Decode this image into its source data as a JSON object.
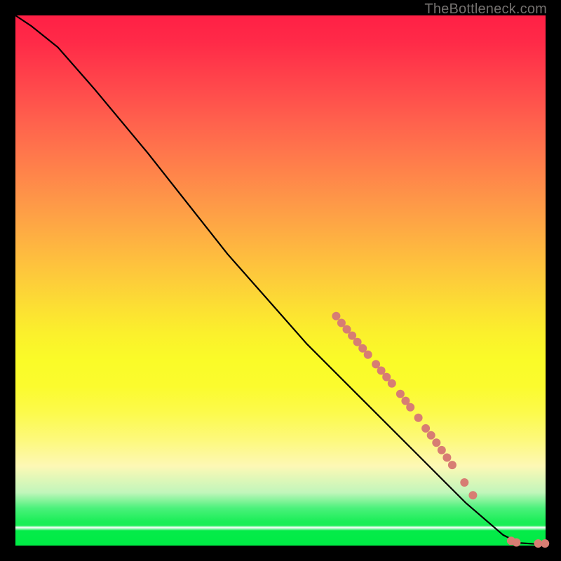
{
  "watermark": "TheBottleneck.com",
  "chart_data": {
    "type": "line",
    "title": "",
    "xlabel": "",
    "ylabel": "",
    "xlim": [
      0,
      100
    ],
    "ylim": [
      0,
      100
    ],
    "curve": [
      {
        "x": 0,
        "y": 100
      },
      {
        "x": 3,
        "y": 98
      },
      {
        "x": 8,
        "y": 94
      },
      {
        "x": 15,
        "y": 86
      },
      {
        "x": 25,
        "y": 74
      },
      {
        "x": 40,
        "y": 55
      },
      {
        "x": 55,
        "y": 38
      },
      {
        "x": 65,
        "y": 28
      },
      {
        "x": 75,
        "y": 18
      },
      {
        "x": 85,
        "y": 8
      },
      {
        "x": 92,
        "y": 2
      },
      {
        "x": 95,
        "y": 0.5
      },
      {
        "x": 98,
        "y": 0.3
      },
      {
        "x": 100,
        "y": 0.3
      }
    ],
    "markers": [
      {
        "x": 60.5,
        "y": 43.3,
        "r": 6
      },
      {
        "x": 61.5,
        "y": 42.0,
        "r": 6
      },
      {
        "x": 62.5,
        "y": 40.8,
        "r": 6
      },
      {
        "x": 63.5,
        "y": 39.6,
        "r": 6
      },
      {
        "x": 64.5,
        "y": 38.4,
        "r": 6
      },
      {
        "x": 65.5,
        "y": 37.2,
        "r": 6
      },
      {
        "x": 66.5,
        "y": 36.0,
        "r": 6
      },
      {
        "x": 68.0,
        "y": 34.2,
        "r": 6
      },
      {
        "x": 69.0,
        "y": 33.0,
        "r": 6
      },
      {
        "x": 70.0,
        "y": 31.8,
        "r": 6
      },
      {
        "x": 71.0,
        "y": 30.6,
        "r": 6
      },
      {
        "x": 72.6,
        "y": 28.6,
        "r": 6
      },
      {
        "x": 73.6,
        "y": 27.3,
        "r": 6
      },
      {
        "x": 74.5,
        "y": 26.1,
        "r": 6
      },
      {
        "x": 76.0,
        "y": 24.1,
        "r": 6
      },
      {
        "x": 77.4,
        "y": 22.1,
        "r": 6
      },
      {
        "x": 78.4,
        "y": 20.8,
        "r": 6
      },
      {
        "x": 79.4,
        "y": 19.4,
        "r": 6
      },
      {
        "x": 80.4,
        "y": 18.0,
        "r": 6
      },
      {
        "x": 81.4,
        "y": 16.6,
        "r": 6
      },
      {
        "x": 82.4,
        "y": 15.2,
        "r": 6
      },
      {
        "x": 84.7,
        "y": 11.9,
        "r": 6
      },
      {
        "x": 86.3,
        "y": 9.5,
        "r": 6
      },
      {
        "x": 93.5,
        "y": 0.9,
        "r": 6
      },
      {
        "x": 94.5,
        "y": 0.6,
        "r": 6
      },
      {
        "x": 98.6,
        "y": 0.4,
        "r": 6
      },
      {
        "x": 99.9,
        "y": 0.4,
        "r": 6
      }
    ],
    "marker_color": "#d77d73",
    "curve_color": "#000000",
    "gradient_stops": [
      {
        "pct": 0,
        "color": "#ff2045"
      },
      {
        "pct": 50,
        "color": "#fdcd3a"
      },
      {
        "pct": 80,
        "color": "#fdf97b"
      },
      {
        "pct": 95,
        "color": "#1aee57"
      },
      {
        "pct": 100,
        "color": "#00eb45"
      }
    ]
  }
}
